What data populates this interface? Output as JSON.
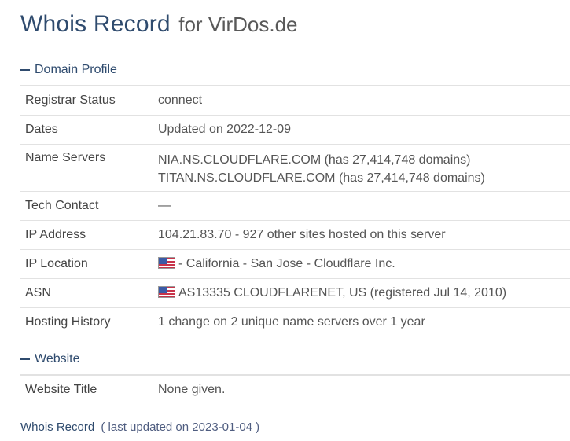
{
  "header": {
    "title": "Whois Record",
    "subtitle": "for VirDos.de"
  },
  "domain_profile": {
    "heading": "Domain Profile",
    "rows": [
      {
        "key": "Registrar Status",
        "value": "connect"
      },
      {
        "key": "Dates",
        "value": "Updated on 2022-12-09"
      },
      {
        "key": "Name Servers",
        "values": [
          "NIA.NS.CLOUDFLARE.COM (has 27,414,748 domains)",
          "TITAN.NS.CLOUDFLARE.COM (has 27,414,748 domains)"
        ]
      },
      {
        "key": "Tech Contact",
        "value": "—"
      },
      {
        "key": "IP Address",
        "value": "104.21.83.70 - 927 other sites hosted on this server"
      },
      {
        "key": "IP Location",
        "value": "- California - San Jose - Cloudflare Inc.",
        "icon": "us-flag-icon"
      },
      {
        "key": "ASN",
        "value": "AS13335 CLOUDFLARENET, US (registered Jul 14, 2010)",
        "icon": "us-flag-icon"
      },
      {
        "key": "Hosting History",
        "value": "1 change on 2 unique name servers over 1 year"
      }
    ]
  },
  "website": {
    "heading": "Website",
    "rows": [
      {
        "key": "Website Title",
        "value": "None given."
      }
    ]
  },
  "footer": {
    "link": "Whois Record",
    "note": "( last updated on 2023-01-04 )"
  },
  "colors": {
    "accent": "#2f4b6e",
    "divider": "#e2e2e2"
  }
}
